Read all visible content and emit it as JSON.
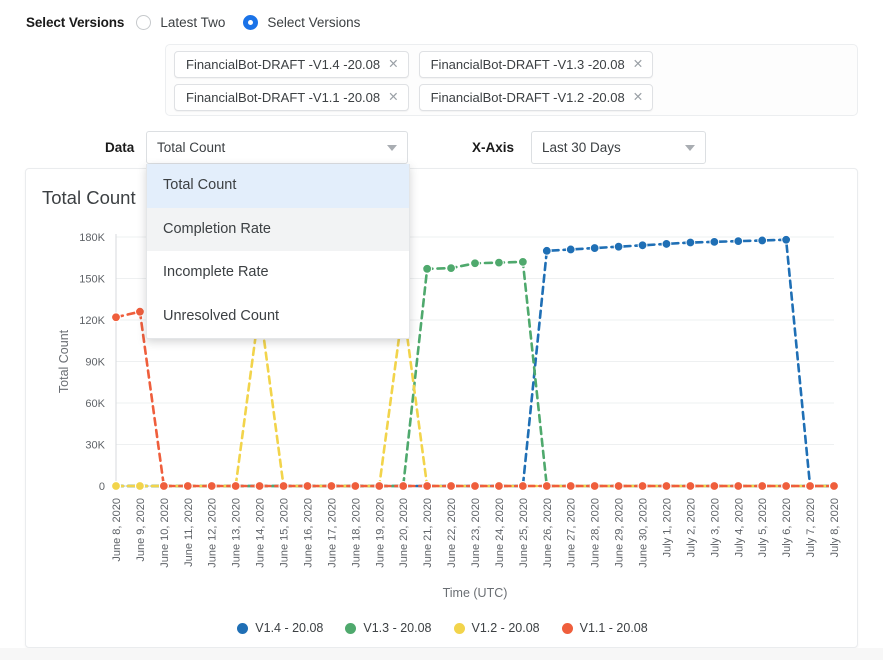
{
  "controls": {
    "versions_label": "Select Versions",
    "radio_options": [
      {
        "label": "Latest Two",
        "checked": false
      },
      {
        "label": "Select Versions",
        "checked": true
      }
    ],
    "chips": [
      {
        "label": "FinancialBot-DRAFT -V1.4 -20.08",
        "close": "✕"
      },
      {
        "label": "FinancialBot-DRAFT -V1.3 -20.08",
        "close": "✕"
      },
      {
        "label": "FinancialBot-DRAFT -V1.1 -20.08",
        "close": "✕"
      },
      {
        "label": "FinancialBot-DRAFT -V1.2 -20.08",
        "close": "✕"
      }
    ],
    "data_select": {
      "label": "Data",
      "value": "Total Count",
      "expanded": true,
      "options": [
        {
          "label": "Total Count",
          "state": "selected"
        },
        {
          "label": "Completion Rate",
          "state": "hover"
        },
        {
          "label": "Incomplete Rate",
          "state": "normal"
        },
        {
          "label": "Unresolved Count",
          "state": "normal"
        }
      ]
    },
    "xaxis_select": {
      "label": "X-Axis",
      "value": "Last 30 Days",
      "options": [
        "Last 30 Days"
      ]
    }
  },
  "chart_data": {
    "type": "line",
    "title": "Total Count",
    "xlabel": "Time (UTC)",
    "ylabel": "Total Count",
    "ylim": [
      0,
      180000
    ],
    "ytick_labels": [
      "0",
      "30K",
      "60K",
      "90K",
      "120K",
      "150K",
      "180K"
    ],
    "ytick_values": [
      0,
      30000,
      60000,
      90000,
      120000,
      150000,
      180000
    ],
    "grid": true,
    "legend_position": "bottom",
    "categories": [
      "June 8, 2020",
      "June 9, 2020",
      "June 10, 2020",
      "June 11, 2020",
      "June 12, 2020",
      "June 13, 2020",
      "June 14, 2020",
      "June 15, 2020",
      "June 16, 2020",
      "June 17, 2020",
      "June 18, 2020",
      "June 19, 2020",
      "June 20, 2020",
      "June 21, 2020",
      "June 22, 2020",
      "June 23, 2020",
      "June 24, 2020",
      "June 25, 2020",
      "June 26, 2020",
      "June 27, 2020",
      "June 28, 2020",
      "June 29, 2020",
      "June 30, 2020",
      "July 1, 2020",
      "July 2, 2020",
      "July 3, 2020",
      "July 4, 2020",
      "July 5, 2020",
      "July 6, 2020",
      "July 7, 2020",
      "July 8, 2020"
    ],
    "series": [
      {
        "name": "V1.4 - 20.08",
        "color": "#1f6fb5",
        "values": [
          0,
          0,
          0,
          0,
          0,
          0,
          0,
          0,
          0,
          0,
          0,
          0,
          0,
          0,
          0,
          0,
          0,
          0,
          170000,
          171000,
          172000,
          173000,
          174000,
          175000,
          176000,
          176500,
          177000,
          177500,
          178000,
          0,
          0
        ]
      },
      {
        "name": "V1.3 - 20.08",
        "color": "#4fa96d",
        "values": [
          0,
          0,
          0,
          0,
          0,
          0,
          0,
          0,
          0,
          0,
          0,
          0,
          0,
          157000,
          157500,
          161000,
          161500,
          162000,
          0,
          0,
          0,
          0,
          0,
          0,
          0,
          0,
          0,
          0,
          0,
          0,
          0
        ]
      },
      {
        "name": "V1.2 - 20.08",
        "color": "#f2d44b",
        "values": [
          0,
          0,
          0,
          0,
          0,
          0,
          130000,
          0,
          0,
          0,
          0,
          0,
          130000,
          0,
          0,
          0,
          0,
          0,
          0,
          0,
          0,
          0,
          0,
          0,
          0,
          0,
          0,
          0,
          0,
          0,
          0
        ]
      },
      {
        "name": "V1.1 - 20.08",
        "color": "#ef5e3c",
        "values": [
          122000,
          126000,
          0,
          0,
          0,
          0,
          0,
          0,
          0,
          0,
          0,
          0,
          0,
          0,
          0,
          0,
          0,
          0,
          0,
          0,
          0,
          0,
          0,
          0,
          0,
          0,
          0,
          0,
          0,
          0,
          0
        ]
      }
    ],
    "legend": [
      {
        "label": "V1.4 - 20.08",
        "color": "#1f6fb5"
      },
      {
        "label": "V1.3 - 20.08",
        "color": "#4fa96d"
      },
      {
        "label": "V1.2 - 20.08",
        "color": "#f2d44b"
      },
      {
        "label": "V1.1 - 20.08",
        "color": "#ef5e3c"
      }
    ]
  }
}
